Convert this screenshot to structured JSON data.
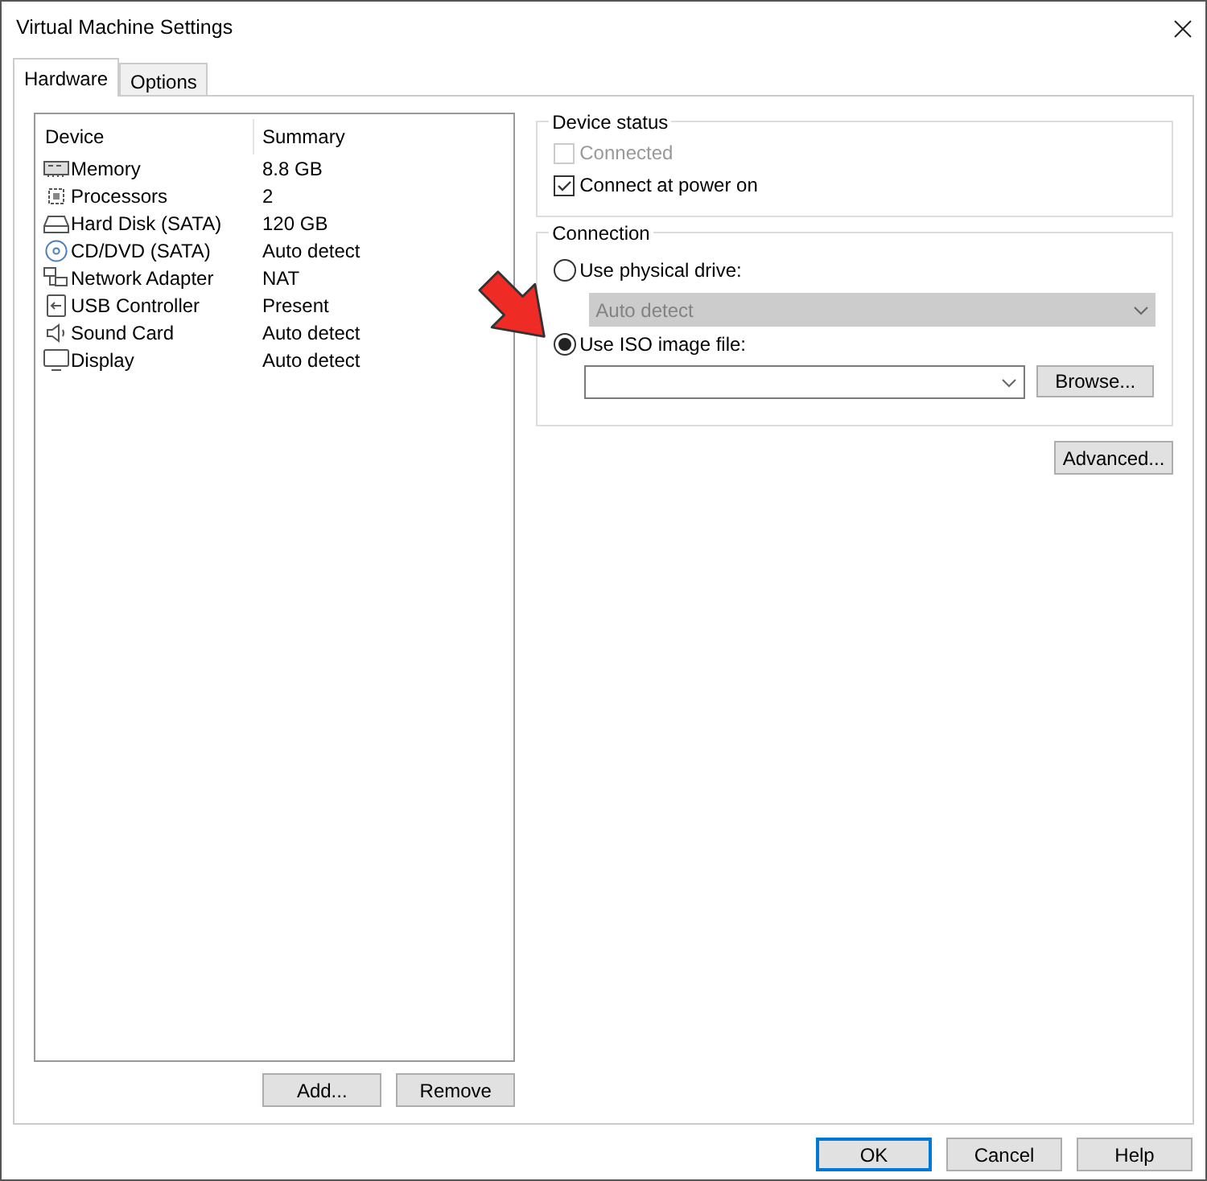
{
  "window": {
    "title": "Virtual Machine Settings"
  },
  "tabs": [
    {
      "label": "Hardware",
      "selected": true
    },
    {
      "label": "Options",
      "selected": false
    }
  ],
  "device_table": {
    "columns": [
      "Device",
      "Summary"
    ],
    "rows": [
      {
        "kind": "memory",
        "device": "Memory",
        "summary": "8.8 GB"
      },
      {
        "kind": "processor",
        "device": "Processors",
        "summary": "2"
      },
      {
        "kind": "disk",
        "device": "Hard Disk (SATA)",
        "summary": "120 GB"
      },
      {
        "kind": "cd",
        "device": "CD/DVD (SATA)",
        "summary": "Auto detect"
      },
      {
        "kind": "network",
        "device": "Network Adapter",
        "summary": "NAT"
      },
      {
        "kind": "usb",
        "device": "USB Controller",
        "summary": "Present"
      },
      {
        "kind": "sound",
        "device": "Sound Card",
        "summary": "Auto detect"
      },
      {
        "kind": "display",
        "device": "Display",
        "summary": "Auto detect"
      }
    ]
  },
  "list_buttons": [
    "Add...",
    "Remove"
  ],
  "device_status": {
    "title": "Device status",
    "options": [
      {
        "label": "Connected",
        "checked": false,
        "disabled": true
      },
      {
        "label": "Connect at power on",
        "checked": true,
        "disabled": false
      }
    ]
  },
  "connection": {
    "title": "Connection",
    "physical": {
      "label": "Use physical drive:",
      "selected": false,
      "value": "Auto detect",
      "disabled": true
    },
    "iso": {
      "label": "Use ISO image file:",
      "selected": true,
      "browse": "Browse..."
    }
  },
  "advanced": "Advanced...",
  "footer_buttons": [
    {
      "label": "OK",
      "default": true
    },
    {
      "label": "Cancel",
      "default": false
    },
    {
      "label": "Help",
      "default": false
    }
  ]
}
